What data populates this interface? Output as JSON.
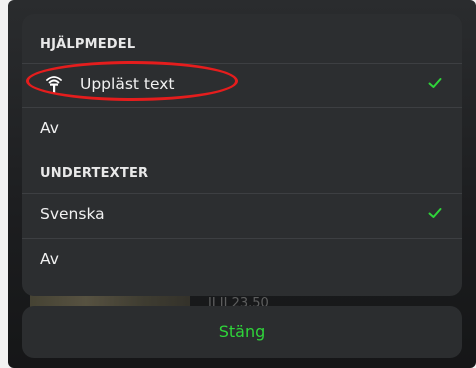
{
  "sheet": {
    "section1": {
      "header": "HJÄLPMEDEL",
      "items": [
        {
          "label": "Uppläst text",
          "icon": "audio-description-icon",
          "selected": true
        },
        {
          "label": "Av",
          "selected": false
        }
      ]
    },
    "section2": {
      "header": "UNDERTEXTER",
      "items": [
        {
          "label": "Svenska",
          "selected": true
        },
        {
          "label": "Av",
          "selected": false
        }
      ]
    }
  },
  "close_button": {
    "label": "Stäng"
  },
  "background": {
    "time_text": "II II 23.50"
  },
  "colors": {
    "accent_green": "#2fd43a",
    "annotation_red": "#e51d1d",
    "sheet_bg": "#2c2e30"
  }
}
